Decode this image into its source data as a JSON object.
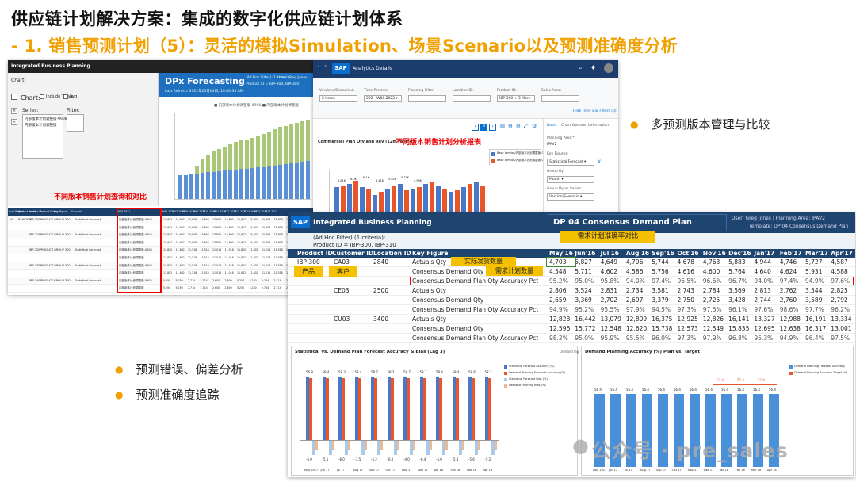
{
  "header": {
    "title": "供应链计划解决方案：集成的数字化供应链计划体系",
    "subtitle": "- 1. 销售预测计划（5）：灵活的模拟Simulation、场景Scenario以及预测准确度分析"
  },
  "bullets": {
    "b1": "多预测版本管理与比较",
    "b2": "预测错误、偏差分析",
    "b3": "预测准确度追踪"
  },
  "colors": {
    "accent": "#f0a000",
    "red_label": "#e00000",
    "sap_blue": "#1b3d6e",
    "bar_blue": "#5b8fd6",
    "bar_green": "#a8c878",
    "bar_orange": "#e8562a"
  },
  "s1": {
    "app": "Integrated Business Planning",
    "chart_lbl": "Chart",
    "chart_sec": "Chart:",
    "include_totals": "Include Totals",
    "avg": "Avg",
    "series": "Series:",
    "filter": "Filter:",
    "item1": "内部版本计划调整版-0908",
    "item2": "内部版本计划调整版",
    "banner": "DPx Forecasting",
    "last_refresh": "Last Refresh: 2021年05月04日, 10:00:33 AM",
    "adhoc": "[Ad Hoc Filter] (1 criteria)",
    "product_id": "Product ID = IBP-300, IBP-300",
    "user": "User: Greg Jones",
    "pa": "Planning Area",
    "legend": "■ 内部版本计划调整版-0908   ■ 内部版本计划调整版",
    "red_label": "不同版本销售计划查询和对比",
    "columns": [
      "Cust Region",
      "Product Family",
      "Product ID",
      "Product Group",
      "Key Figure",
      "Scenario",
      "W05.2021",
      "W06.2021",
      "W07.2021",
      "W08.2021",
      "W09.2021",
      "W10.2021",
      "W11.2021",
      "W12.2021",
      "W13.2021",
      "W14.2021",
      "W15.2021",
      "W16.2021"
    ],
    "row_cust": "NA",
    "row_family": "RAW 300",
    "pid": [
      "IBP-300",
      "IBP-310",
      "IBP-320",
      "IBP-330",
      "IBP-340"
    ],
    "pgroup": "PRODUCT GROUP 300",
    "kf": "Statistical Forecast",
    "sc": "内部版本计划调整版-0908",
    "sc2": "内部版本计划调整版",
    "rows": [
      [
        "15,907",
        "15,907",
        "15,808",
        "15,808",
        "13,800",
        "13,800"
      ],
      [
        "15,907",
        "15,907",
        "15,808",
        "15,808",
        "13,800",
        "13,800"
      ],
      [
        "11,802",
        "11,802",
        "11,518",
        "11,518",
        "11,016",
        "11,016"
      ],
      [
        "11,802",
        "11,802",
        "11,518",
        "11,518",
        "11,016",
        "11,016"
      ],
      [
        "5,250",
        "5,250",
        "2,714",
        "2,714",
        "2,600",
        "2,600"
      ]
    ]
  },
  "s2": {
    "app": "Analytics Details",
    "versions": "Versions/Scenarios:",
    "v_val": "2 Items",
    "time": "Time Periods:",
    "t_val": "202 - W08.2022 ▾",
    "pf": "Planning Filter:",
    "loc": "Location ID:",
    "prod": "Product ID:",
    "p_val": "IBP-300 + 3 More",
    "sales": "Sales Area:",
    "hide": "Hide Filter Bar   Filters (0)",
    "chart_title": "Commercial Plan Qty and Rev (12m rolling)",
    "red_label": "不同版本销售计划分析报表",
    "leg1": "Base Version/内部版本计划调整版-0908",
    "leg2": "Base Version/内部版本计划调整版-0908",
    "tabs": [
      "Basic",
      "Chart Options",
      "Information"
    ],
    "planning_area": "Planning Area:*",
    "pa_val": "IPAV2",
    "kf": "Key Figures:",
    "kf_val": "Statistical Forecast ▾",
    "group_by": "Group By:",
    "gb_val": "Month ▾",
    "group_series": "Group By as Series:",
    "gs_val": "Version/Scenario ▾",
    "bar_labels": [
      "5.81K",
      "6.0K",
      "6.1K",
      "6.41K",
      "5.82K",
      "5.71K",
      "4.95K"
    ]
  },
  "s3": {
    "app": "Integrated Business Planning",
    "plan_title": "DP 04 Consensus Demand Plan",
    "user": "User: Greg Jones | Planning Area: IPAV2",
    "template": "Template: DP 04 Consensus Demand Plan",
    "adhoc": "(Ad Hoc Filter) (1 criteria):",
    "filter": "Product ID = IBP-300, IBP-310",
    "headers": [
      "Product ID",
      "Customer ID",
      "Location ID",
      "Key Figure"
    ],
    "months": [
      "May'16",
      "Jun'16",
      "Jul'16",
      "Aug'16",
      "Sep'16",
      "Oct'16",
      "Nov'16",
      "Dec'16",
      "Jan'17",
      "Feb'17",
      "Mar'17",
      "Apr'17"
    ],
    "orange_top": "需求计划准确率对比",
    "orange_actual": "实际发货数量",
    "orange_product": "产品",
    "orange_customer": "客户",
    "orange_demand": "需求计划数量",
    "pid": "IBP-300",
    "cust": [
      "CA03",
      "CE03",
      "CU03"
    ],
    "loc": [
      "2840",
      "2500",
      "3400"
    ],
    "kf": [
      "Actuals Qty",
      "Consensus Demand Qty",
      "Consensus Demand Plan Qty Accuracy Pct"
    ],
    "data": [
      [
        "4,703",
        "5,827",
        "4,649",
        "4,796",
        "5,744",
        "4,678",
        "4,763",
        "5,883",
        "4,944",
        "4,746",
        "5,727",
        "4,587"
      ],
      [
        "4,548",
        "5,711",
        "4,602",
        "4,586",
        "5,756",
        "4,616",
        "4,600",
        "5,764",
        "4,640",
        "4,624",
        "5,931",
        "4,588"
      ],
      [
        "95.2%",
        "95.0%",
        "95.8%",
        "94.0%",
        "97.4%",
        "96.5%",
        "96.6%",
        "96.7%",
        "94.0%",
        "97.4%",
        "94.9%",
        "97.6%"
      ],
      [
        "2,806",
        "3,524",
        "2,831",
        "2,734",
        "3,581",
        "2,743",
        "2,784",
        "3,569",
        "2,813",
        "2,762",
        "3,544",
        "2,825"
      ],
      [
        "2,659",
        "3,369",
        "2,702",
        "2,697",
        "3,379",
        "2,750",
        "2,725",
        "3,428",
        "2,744",
        "2,760",
        "3,589",
        "2,792"
      ],
      [
        "94.9%",
        "95.2%",
        "95.5%",
        "97.9%",
        "94.5%",
        "97.3%",
        "97.5%",
        "96.1%",
        "97.6%",
        "98.6%",
        "97.7%",
        "96.2%"
      ],
      [
        "12,828",
        "16,442",
        "13,079",
        "12,809",
        "16,375",
        "12,925",
        "12,826",
        "16,141",
        "13,327",
        "12,988",
        "16,191",
        "13,334"
      ],
      [
        "12,596",
        "15,772",
        "12,548",
        "12,620",
        "15,738",
        "12,573",
        "12,549",
        "15,835",
        "12,695",
        "12,638",
        "16,317",
        "13,001"
      ],
      [
        "98.2%",
        "95.0%",
        "95.9%",
        "95.5%",
        "96.0%",
        "97.3%",
        "97.9%",
        "96.8%",
        "95.3%",
        "94.9%",
        "96.4%",
        "97.5%"
      ]
    ],
    "chart1": {
      "title": "Statistical vs. Demand Plan Forecast Accuracy & Bias (Lag 3)",
      "legend": [
        "Statistical Forecast Accuracy (%)",
        "Demand Planning Forecast Accuracy (%)",
        "Statistical Forecast Bias (%)",
        "Demand Planning Bias (%)"
      ],
      "months": [
        "May 2017",
        "Jun 17",
        "Jul 17",
        "Aug 17",
        "Sep 17",
        "Oct 17",
        "Nov 17",
        "Dec 17",
        "Jan 18",
        "Feb 18",
        "Mar 18",
        "Apr 18"
      ],
      "acc_labels": [
        "56.8",
        "58.4",
        "58.3",
        "58.4",
        "58.7",
        "58.2",
        "58.7",
        "58.7",
        "58.4",
        "58.4",
        "58.6",
        "58.3"
      ],
      "bias_labels": [
        "-6.0",
        "-5.1",
        "-6.0",
        "-3.5",
        "-5.2",
        "-6.0",
        "-4.0",
        "-6.4",
        "-5.0",
        "-5.8",
        "-5.6",
        "-5.2"
      ],
      "corner": "Demand lag"
    },
    "chart2": {
      "title": "Demand Planning Accuracy (%) Plan vs. Target",
      "legend": [
        "Demand Planning Forecast Accuracy",
        "Demand Planning Accuracy Target (%)"
      ],
      "values": [
        "56.4",
        "56.4",
        "56.4",
        "56.4",
        "56.4",
        "56.4",
        "56.4",
        "56.4",
        "56.4",
        "56.4",
        "56.4",
        "56.4"
      ],
      "target_labels": [
        "52.4",
        "52.4",
        "52.4"
      ],
      "months": [
        "May 2017",
        "Jun 17",
        "Jul 17",
        "Aug 17",
        "Sep 17",
        "Oct 17",
        "Nov 17",
        "Dec 17",
        "Jan 18",
        "Feb 18",
        "Mar 18",
        "Apr 18"
      ]
    }
  },
  "watermark": "公众号 · pre_sales"
}
